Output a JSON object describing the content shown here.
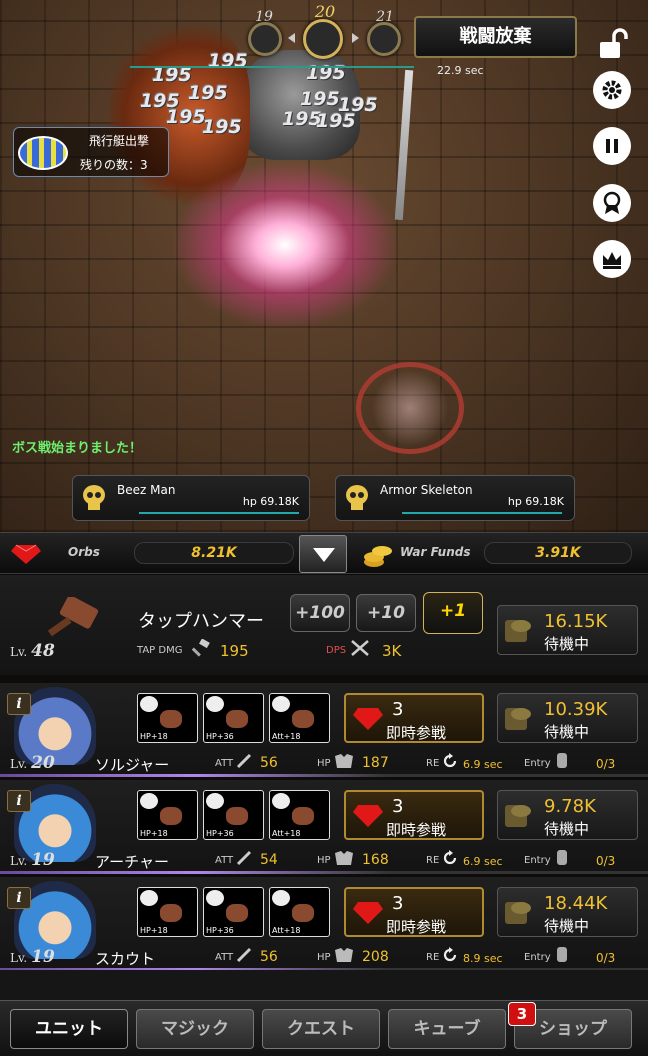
{
  "waves": {
    "prev": "19",
    "current": "20",
    "next": "21"
  },
  "battle": {
    "give_up": "戦闘放棄",
    "timer": "22.9 sec",
    "boss_message": "ボス戦始まりました！"
  },
  "damage_numbers": [
    "195",
    "195",
    "195",
    "195",
    "195",
    "195",
    "195",
    "195",
    "195",
    "195",
    "195"
  ],
  "airship": {
    "title": "飛行艇出撃",
    "remaining": "残りの数：3"
  },
  "side_icons": [
    "lock-open-icon",
    "gear-icon",
    "pause-icon",
    "medal-icon",
    "crown-icon"
  ],
  "bosses": [
    {
      "name": "Beez Man",
      "hp": "hp 69.18K"
    },
    {
      "name": "Armor Skeleton",
      "hp": "hp 69.18K"
    }
  ],
  "resources": {
    "orbs_label": "Orbs",
    "orbs": "8.21K",
    "funds_label": "War Funds",
    "funds": "3.91K"
  },
  "hammer": {
    "name": "タップハンマー",
    "level_prefix": "Lv.",
    "level": "48",
    "buttons": [
      "+100",
      "+10",
      "+1"
    ],
    "tap_dmg_label": "TAP DMG",
    "tap_dmg": "195",
    "dps_label": "DPS",
    "dps": "3K",
    "cost": "16.15K",
    "status": "待機中"
  },
  "units": [
    {
      "name": "ソルジャー",
      "level": "20",
      "equip": [
        "HP+18",
        "HP+36",
        "Att+18"
      ],
      "orbs": "3",
      "join": "即時参戦",
      "att": "56",
      "hp": "187",
      "re": "6.9 sec",
      "entry": "0/3",
      "cost": "10.39K",
      "status": "待機中"
    },
    {
      "name": "アーチャー",
      "level": "19",
      "equip": [
        "HP+18",
        "HP+36",
        "Att+18"
      ],
      "orbs": "3",
      "join": "即時参戦",
      "att": "54",
      "hp": "168",
      "re": "6.9 sec",
      "entry": "0/3",
      "cost": "9.78K",
      "status": "待機中"
    },
    {
      "name": "スカウト",
      "level": "19",
      "equip": [
        "HP+18",
        "HP+36",
        "Att+18"
      ],
      "orbs": "3",
      "join": "即時参戦",
      "att": "56",
      "hp": "208",
      "re": "8.9 sec",
      "entry": "0/3",
      "cost": "18.44K",
      "status": "待機中"
    }
  ],
  "stat_labels": {
    "lv": "Lv.",
    "att": "ATT",
    "hp": "HP",
    "re": "RE",
    "entry": "Entry",
    "info": "i"
  },
  "tabs": [
    "ユニット",
    "マジック",
    "クエスト",
    "キューブ",
    "ショップ"
  ],
  "shop_badge": "3"
}
